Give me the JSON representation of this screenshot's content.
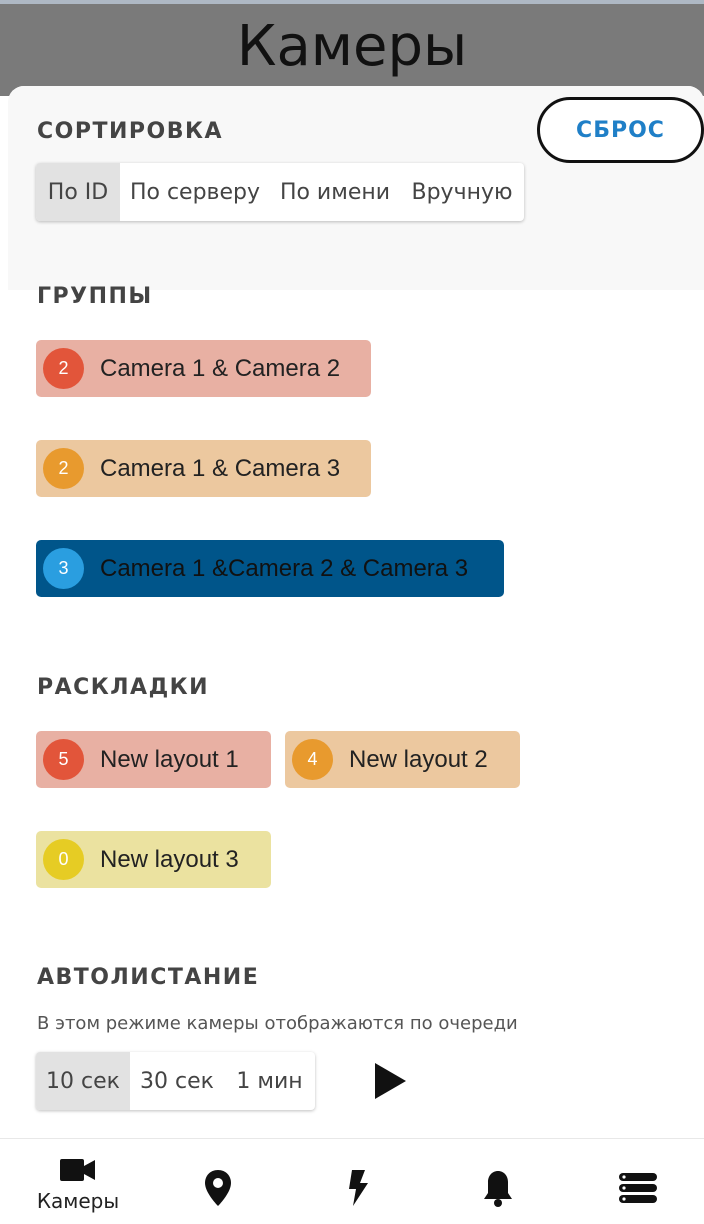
{
  "header": {
    "title": "Камеры"
  },
  "reset_label": "СБРОС",
  "sorting": {
    "title": "СОРТИРОВКА",
    "options": [
      "По ID",
      "По серверу",
      "По имени",
      "Вручную"
    ],
    "selected": "По ID"
  },
  "groups": {
    "title": "ГРУППЫ",
    "items": [
      {
        "count": "2",
        "label": "Camera 1 & Camera 2",
        "bg": "#e8b0a3",
        "badge": "#e2553a",
        "text": "#222222"
      },
      {
        "count": "2",
        "label": "Camera 1 & Camera 3",
        "bg": "#ecc89f",
        "badge": "#e89a2e",
        "text": "#222222"
      },
      {
        "count": "3",
        "label": "Camera 1 &Camera 2 & Camera 3",
        "bg": "#00558a",
        "badge": "#2a9ee0",
        "text": "#111111"
      }
    ]
  },
  "layouts": {
    "title": "РАСКЛАДКИ",
    "items": [
      {
        "count": "5",
        "label": "New layout 1",
        "bg": "#e8b0a3",
        "badge": "#e2553a",
        "text": "#222222"
      },
      {
        "count": "4",
        "label": "New layout 2",
        "bg": "#ecc89f",
        "badge": "#e89a2e",
        "text": "#222222"
      },
      {
        "count": "0",
        "label": "New layout 3",
        "bg": "#ebe2a0",
        "badge": "#e6cc24",
        "text": "#222222"
      }
    ]
  },
  "autoscroll": {
    "title": "АВТОЛИСТАНИЕ",
    "description": "В этом режиме камеры отображаются по очереди",
    "options": [
      "10 сек",
      "30 сек",
      "1 мин"
    ],
    "selected": "10 сек"
  },
  "bottom_nav": {
    "items": [
      {
        "icon": "camera-icon",
        "label": "Камеры",
        "active": true
      },
      {
        "icon": "map-pin-icon",
        "label": ""
      },
      {
        "icon": "lightning-icon",
        "label": ""
      },
      {
        "icon": "bell-icon",
        "label": ""
      },
      {
        "icon": "server-stack-icon",
        "label": ""
      }
    ]
  }
}
